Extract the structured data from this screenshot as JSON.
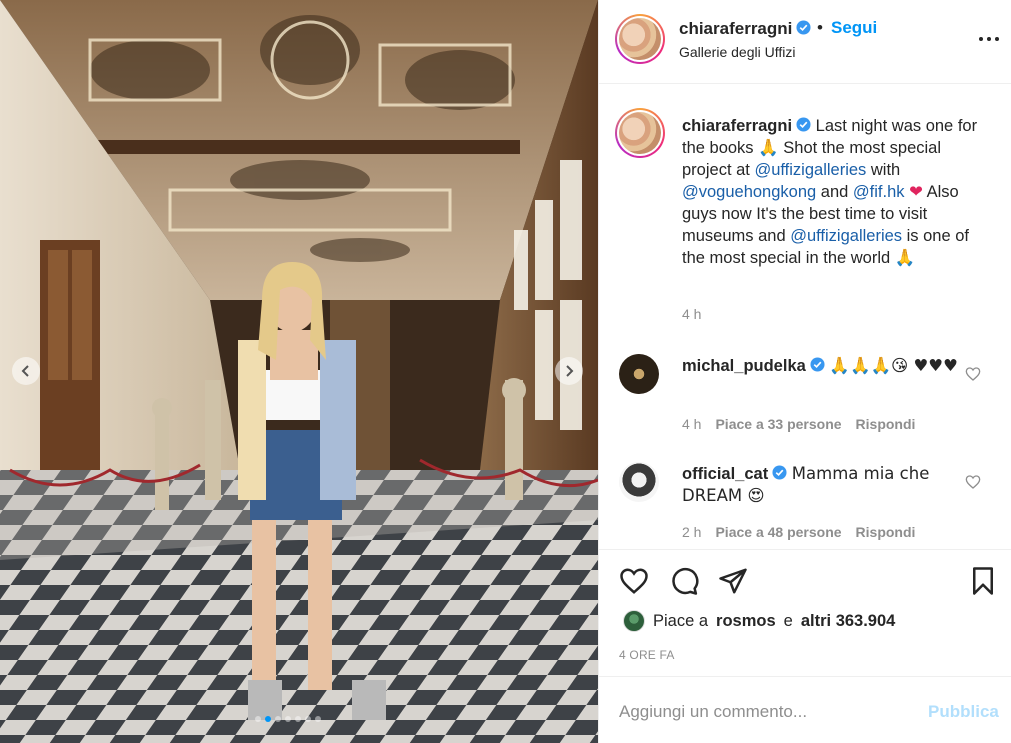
{
  "post": {
    "author": "chiaraferragni",
    "follow_label": "Segui",
    "bullet": "•",
    "location": "Gallerie degli Uffizi",
    "more_icon": "more-horizontal-icon"
  },
  "caption": {
    "username": "chiaraferragni",
    "part1": "Last night was one for the books ",
    "emoji1": "🙏",
    "part2": " Shot the most special project at ",
    "mention1": "@uffizigalleries",
    "part3": " with ",
    "mention2": "@voguehongkong",
    "part4": " and ",
    "mention3": "@fif.hk",
    "emoji2": "❤",
    "part5": " Also guys now It's the best time to visit museums and ",
    "mention4": "@uffizigalleries",
    "part6": " is one of the most special in the world ",
    "emoji3": "🙏",
    "time": "4 h"
  },
  "comments": [
    {
      "username": "michal_pudelka",
      "text": "🙏🙏🙏😘 ♥♥♥",
      "time": "4 h",
      "likes": "Piace a 33 persone",
      "reply": "Rispondi"
    },
    {
      "username": "official_cat",
      "text": "Mamma mia che DREAM 😍",
      "time": "2 h",
      "likes": "Piace a 48 persone",
      "reply": "Rispondi"
    }
  ],
  "actions": {
    "likes_prefix": "Piace a",
    "likes_user": "rosmos",
    "likes_mid": "e",
    "likes_others": "altri 363.904",
    "posted_ago": "4 ORE FA"
  },
  "comment_box": {
    "placeholder": "Aggiungi un commento...",
    "publish_label": "Pubblica"
  },
  "colors": {
    "link": "#0095f6",
    "muted": "#8e8e8e",
    "text": "#262626",
    "publish_disabled": "#b2dffc"
  },
  "carousel": {
    "slides": 7,
    "active_slide": 1
  }
}
